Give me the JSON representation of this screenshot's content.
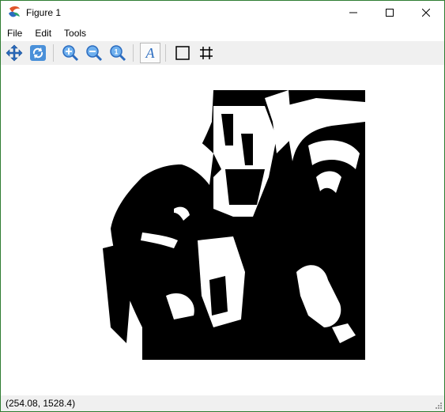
{
  "window": {
    "title": "Figure 1",
    "controls": [
      "minimize",
      "maximize",
      "close"
    ]
  },
  "menu": {
    "items": [
      "File",
      "Edit",
      "Tools"
    ]
  },
  "toolbar": {
    "buttons": [
      {
        "name": "pan-icon",
        "label": "Pan"
      },
      {
        "name": "home-icon",
        "label": "Reset"
      },
      {
        "name": "zoom-in-icon",
        "label": "Zoom in"
      },
      {
        "name": "zoom-out-icon",
        "label": "Zoom out"
      },
      {
        "name": "zoom-fit-icon",
        "label": "Zoom to fit"
      },
      {
        "name": "axis-label-icon",
        "label": "A"
      },
      {
        "name": "frame-icon",
        "label": "Frame"
      },
      {
        "name": "grid-icon",
        "label": "Grid"
      }
    ]
  },
  "figure": {
    "image_description": "black and white thresholded photo"
  },
  "status": {
    "coords": "(254.08, 1528.4)"
  },
  "colors": {
    "accent_border": "#2f7d32",
    "toolbar_bg": "#f0f0f0",
    "icon_blue": "#2a6bbf"
  }
}
